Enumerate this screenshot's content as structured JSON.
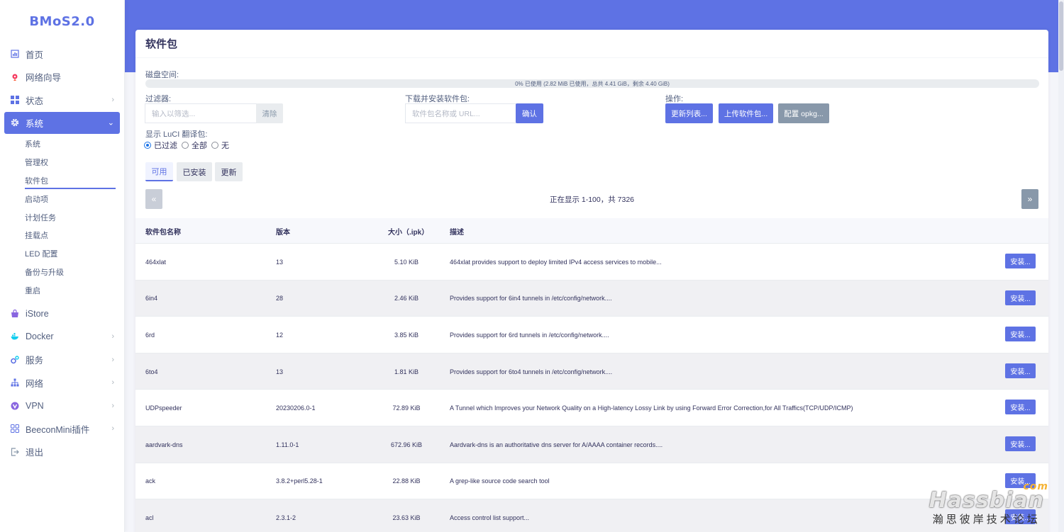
{
  "brand": "BMoS2.0",
  "sidebar": {
    "items": [
      {
        "label": "首页",
        "icon": "dashboard-icon"
      },
      {
        "label": "网络向导",
        "icon": "wizard-icon"
      },
      {
        "label": "状态",
        "icon": "grid-icon"
      },
      {
        "label": "系统",
        "icon": "gear-icon"
      },
      {
        "label": "iStore",
        "icon": "store-icon"
      },
      {
        "label": "Docker",
        "icon": "docker-icon"
      },
      {
        "label": "服务",
        "icon": "services-icon"
      },
      {
        "label": "网络",
        "icon": "network-icon"
      },
      {
        "label": "VPN",
        "icon": "vpn-icon"
      },
      {
        "label": "BeeconMini插件",
        "icon": "plugin-icon"
      },
      {
        "label": "退出",
        "icon": "logout-icon"
      }
    ],
    "system_sub": [
      "系统",
      "管理权",
      "软件包",
      "启动项",
      "计划任务",
      "挂载点",
      "LED 配置",
      "备份与升级",
      "重启"
    ]
  },
  "page": {
    "title": "软件包",
    "disk_label": "磁盘空间:",
    "disk_usage": "0% 已使用 (2.82 MiB 已使用，总共 4.41 GiB，剩余 4.40 GiB)",
    "filter_label": "过滤器:",
    "filter_placeholder": "输入以筛选...",
    "clear_label": "清除",
    "download_label": "下载并安装软件包:",
    "download_placeholder": "软件包名称或 URL...",
    "confirm_label": "确认",
    "actions_label": "操作:",
    "update_lists": "更新列表...",
    "upload_package": "上传软件包...",
    "configure_opkg": "配置 opkg...",
    "translation_label": "显示 LuCI 翻译包:",
    "radio_filtered": "已过滤",
    "radio_all": "全部",
    "radio_none": "无",
    "tabs": [
      "可用",
      "已安装",
      "更新"
    ],
    "prev": "«",
    "next": "»",
    "pager_info": "正在显示 1-100，共 7326"
  },
  "table": {
    "headers": [
      "软件包名称",
      "版本",
      "大小（.ipk）",
      "描述"
    ],
    "install_label": "安装...",
    "rows": [
      {
        "name": "464xlat",
        "version": "13",
        "size": "5.10 KiB",
        "desc": "464xlat provides support to deploy limited IPv4 access services to mobile..."
      },
      {
        "name": "6in4",
        "version": "28",
        "size": "2.46 KiB",
        "desc": "Provides support for 6in4 tunnels in /etc/config/network...."
      },
      {
        "name": "6rd",
        "version": "12",
        "size": "3.85 KiB",
        "desc": "Provides support for 6rd tunnels in /etc/config/network...."
      },
      {
        "name": "6to4",
        "version": "13",
        "size": "1.81 KiB",
        "desc": "Provides support for 6to4 tunnels in /etc/config/network...."
      },
      {
        "name": "UDPspeeder",
        "version": "20230206.0-1",
        "size": "72.89 KiB",
        "desc": "A Tunnel which Improves your Network Quality on a High-latency Lossy Link by using Forward Error Correction,for All Traffics(TCP/UDP/ICMP)"
      },
      {
        "name": "aardvark-dns",
        "version": "1.11.0-1",
        "size": "672.96 KiB",
        "desc": "Aardvark-dns is an authoritative dns server for A/AAAA container records...."
      },
      {
        "name": "ack",
        "version": "3.8.2+perl5.28-1",
        "size": "22.88 KiB",
        "desc": "A grep-like source code search tool"
      },
      {
        "name": "acl",
        "version": "2.3.1-2",
        "size": "23.63 KiB",
        "desc": "Access control list support..."
      }
    ]
  },
  "watermark": {
    "logo": "Hassbian",
    "com": "com",
    "sub": "瀚思彼岸技术论坛"
  },
  "colors": {
    "accent": "#5e72e4",
    "sidebar_bg": "#ffffff",
    "page_bg": "#f4f5fa"
  }
}
